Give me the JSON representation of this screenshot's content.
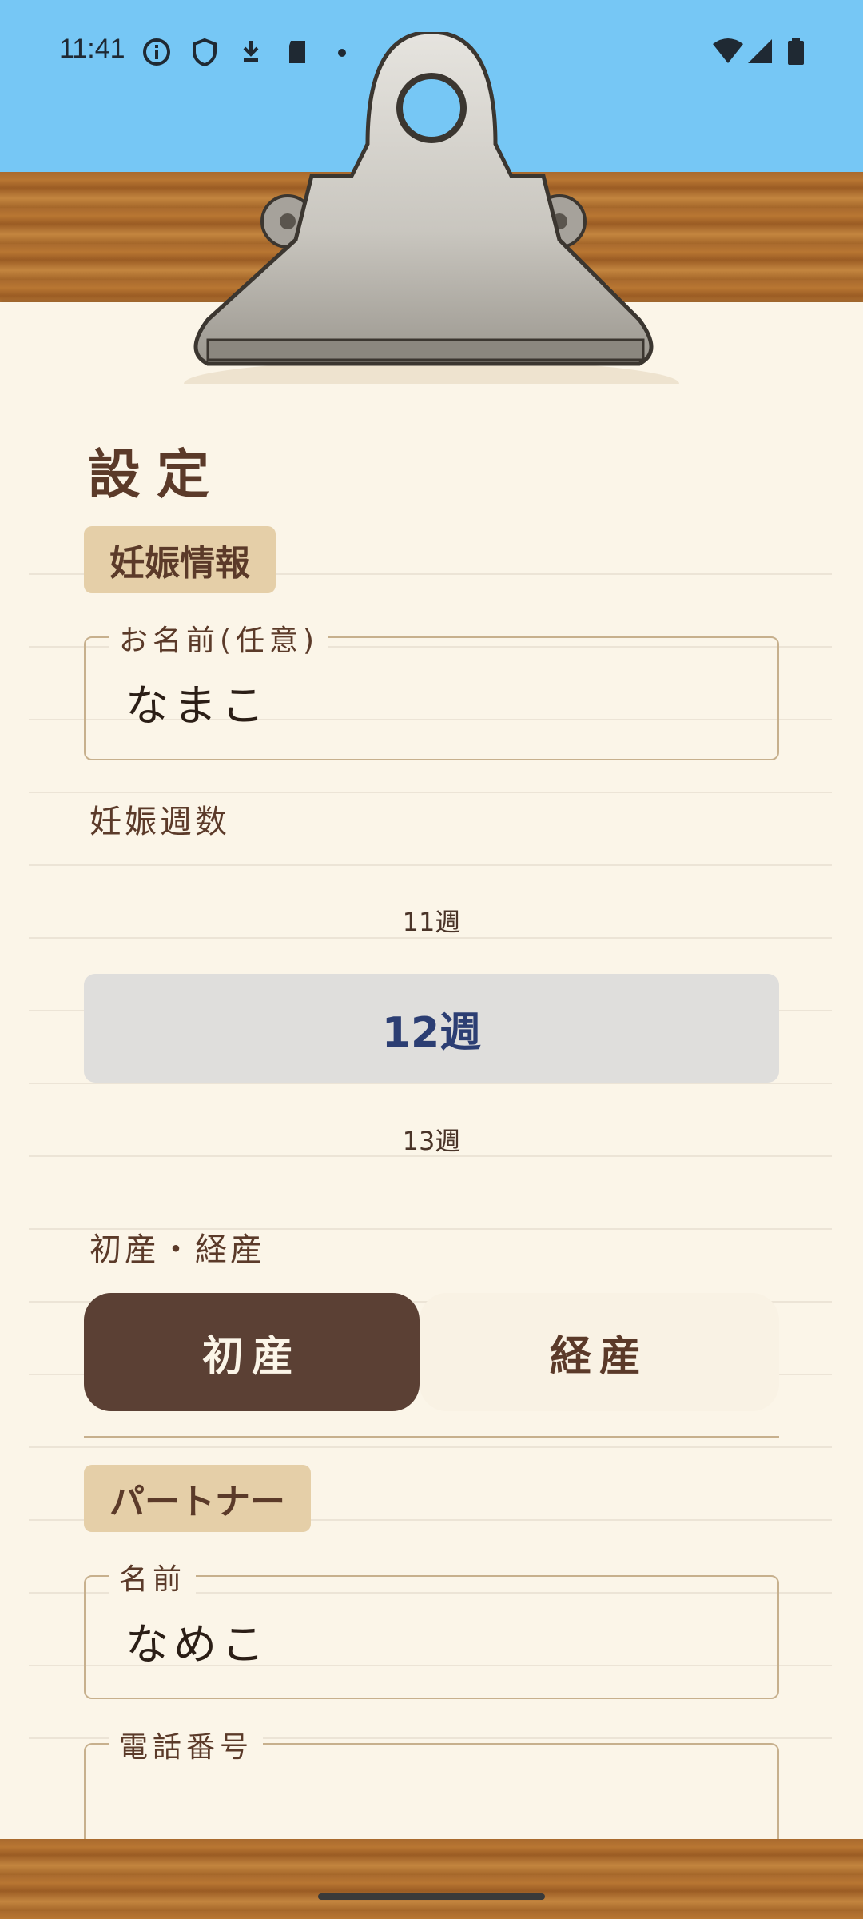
{
  "status_bar": {
    "time": "11:41"
  },
  "page": {
    "title": "設定"
  },
  "pregnancy": {
    "section_label": "妊娠情報",
    "name_field": {
      "label": "お名前(任意)",
      "value": "なまこ"
    },
    "weeks_label": "妊娠週数",
    "weeks_picker": {
      "previous": "11週",
      "selected": "12週",
      "next": "13週"
    },
    "parity_label": "初産・経産",
    "parity_options": [
      "初産",
      "経産"
    ],
    "parity_selected": "初産"
  },
  "partner": {
    "section_label": "パートナー",
    "name_field": {
      "label": "名前",
      "value": "なめこ"
    },
    "phone_field": {
      "label": "電話番号"
    }
  },
  "colors": {
    "accent": "#5b4034",
    "tag": "#e5cfa8",
    "sky": "#76c7f5"
  }
}
